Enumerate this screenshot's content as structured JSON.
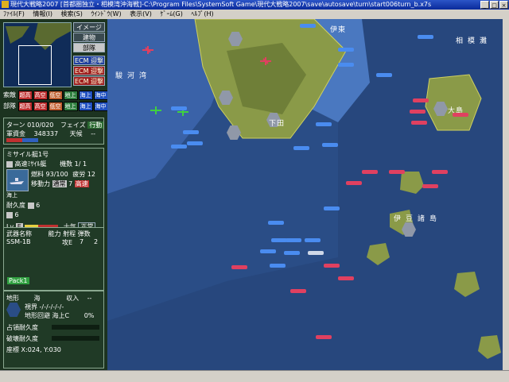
{
  "window": {
    "title": "現代大戦略2007 [首都圏独立・相模湾沖海戦]-C:\\Program Files\\SystemSoft Game\\現代大戦略2007\\save\\autosave\\turn\\start006turn_b.x7s",
    "buttons": [
      "_",
      "□",
      "×"
    ]
  },
  "menu": [
    "ﾌｧｲﾙ(F)",
    "情報(I)",
    "検索(S)",
    "ｳｲﾝﾄﾞｳ(W)",
    "表示(V)",
    "ｹﾞｰﾑ(G)",
    "ﾍﾙﾌﾟ(H)"
  ],
  "sidebar": {
    "map_buttons": [
      "イメージ",
      "建物",
      "部隊"
    ],
    "ecm": [
      "ECM 迎撃",
      "ECM 迎撃",
      "ECM 迎撃"
    ],
    "enemy_label": "索敵",
    "unit_label": "部隊",
    "filters": [
      "超高",
      "高空",
      "低空",
      "地上",
      "海上",
      "海中"
    ],
    "turn_label": "ターン",
    "turn_value": "010/020",
    "phase_label": "フェイズ",
    "phase_value": "行動",
    "funds_label": "軍資金",
    "funds_value": "348337",
    "weather_label": "天候",
    "weather_value": "--",
    "unit_name": "ミサイル艇1号",
    "unit_type": "高速ﾐｻｲﾙ艇",
    "count_label": "機数",
    "count_value": "1/ 1",
    "fuel_label": "燃料",
    "fuel_value": "93/100",
    "fatigue_label": "疲労",
    "fatigue_value": "12",
    "move_label": "移動力",
    "move_mode": "通常",
    "move_value": "7",
    "move_badge": "高速",
    "unit_class": "海上",
    "durability_label": "耐久度",
    "durability_a": "6",
    "durability_b": "6",
    "level_label": "Lv",
    "level_value": "E",
    "morale_label": "士気",
    "morale_value": "正常",
    "weapons_header": [
      "武器名称",
      "能力",
      "射程",
      "弾数"
    ],
    "weapons": [
      {
        "name": "SSM-1B",
        "ability": "攻E",
        "range": "7",
        "ammo": "2"
      }
    ],
    "pack_label": "Pack1",
    "terrain_label": "地形",
    "terrain_value": "海",
    "income_label": "収入",
    "income_value": "--",
    "view_label": "視界",
    "view_value": "-/-/-/-/-/-",
    "road_label": "地形回避",
    "road_value": "海上C",
    "road_pct": "0%",
    "occupy_label": "占領耐久度",
    "destroy_label": "破壊耐久度",
    "coord_label": "座標",
    "coord_value": "X:024, Y:030"
  },
  "map": {
    "places": [
      {
        "name": "駿河湾"
      },
      {
        "name": "相模灘"
      },
      {
        "name": "伊豆諸島"
      },
      {
        "name": "伊東"
      },
      {
        "name": "下田"
      },
      {
        "name": "大島"
      }
    ]
  },
  "colors": {
    "deep_sea": "#2a4d86",
    "shallow_sea": "#4a78c0",
    "land": "#8a9a48",
    "sidebar_bg": "#1c3320",
    "enemy": "#e04060",
    "friendly": "#4a8cf0"
  }
}
